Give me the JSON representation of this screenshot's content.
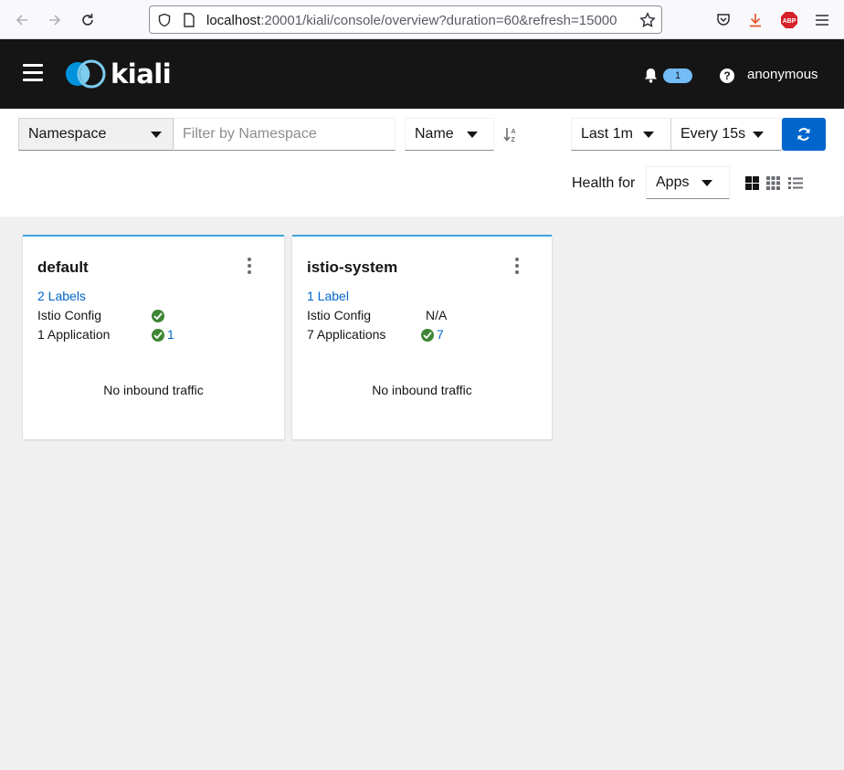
{
  "browser": {
    "url_host": "localhost",
    "url_rest": ":20001/kiali/console/overview?duration=60&refresh=15000"
  },
  "masthead": {
    "logo_text": "kiali",
    "notification_count": "1",
    "help_symbol": "?",
    "user": "anonymous"
  },
  "toolbar": {
    "filter_type": "Namespace",
    "filter_placeholder": "Filter by Namespace",
    "sort_field": "Name",
    "duration": "Last 1m",
    "refresh_interval": "Every 15s",
    "health_label": "Health for",
    "health_type": "Apps"
  },
  "cards": [
    {
      "title": "default",
      "labels": "2 Labels",
      "istio_config_label": "Istio Config",
      "istio_config_status": "ok",
      "applications_label": "1 Application",
      "applications_count": "1",
      "traffic": "No inbound traffic"
    },
    {
      "title": "istio-system",
      "labels": "1 Label",
      "istio_config_label": "Istio Config",
      "istio_config_value": "N/A",
      "applications_label": "7 Applications",
      "applications_count": "7",
      "traffic": "No inbound traffic"
    }
  ],
  "colors": {
    "masthead_bg": "#151515",
    "accent_blue": "#0066cc",
    "card_border": "#39a5dc",
    "healthy_green": "#3e8635",
    "badge_bg": "#73bcf7"
  }
}
